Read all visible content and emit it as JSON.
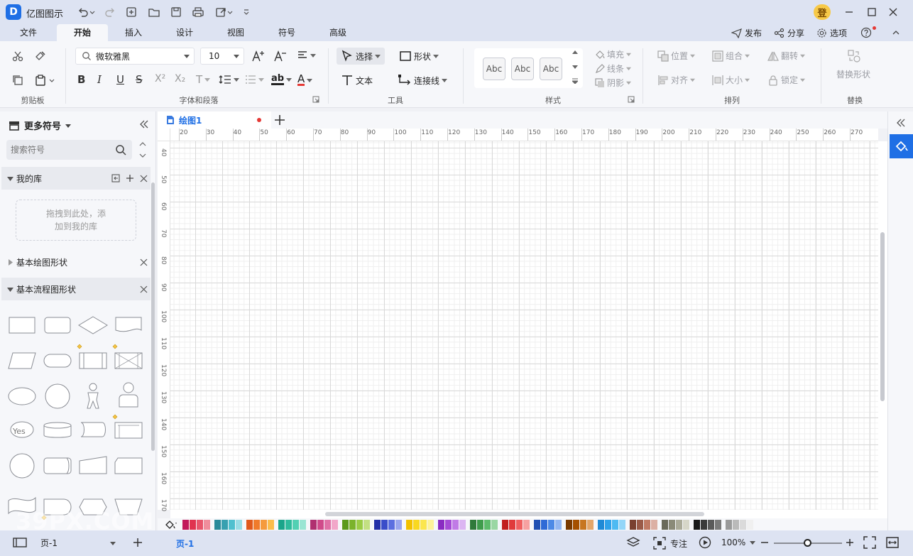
{
  "app": {
    "logo": "D",
    "title": "亿图图示",
    "login": "登"
  },
  "menu": {
    "tabs": [
      {
        "label": "文件",
        "active": false
      },
      {
        "label": "开始",
        "active": true
      },
      {
        "label": "插入",
        "active": false
      },
      {
        "label": "设计",
        "active": false
      },
      {
        "label": "视图",
        "active": false
      },
      {
        "label": "符号",
        "active": false
      },
      {
        "label": "高级",
        "active": false
      }
    ],
    "publish": "发布",
    "share": "分享",
    "options": "选项"
  },
  "ribbon": {
    "groups": {
      "clipboard": "剪贴板",
      "font": "字体和段落",
      "tools": "工具",
      "styles": "样式",
      "arrange": "排列",
      "replace": "替换"
    },
    "font_name": "微软雅黑",
    "font_size": "10",
    "select": "选择",
    "shape": "形状",
    "text": "文本",
    "connector": "连接线",
    "style_sample": "Abc",
    "fill": "填充",
    "line": "线条",
    "shadow": "阴影",
    "position": "位置",
    "group": "组合",
    "flip": "翻转",
    "align": "对齐",
    "size": "大小",
    "lock": "锁定",
    "replace_shape": "替换形状"
  },
  "left_panel": {
    "title": "更多符号",
    "search_placeholder": "搜索符号",
    "my_library": "我的库",
    "drop_hint_line1": "拖拽到此处，添",
    "drop_hint_line2": "加到我的库",
    "basic_shapes": "基本绘图形状",
    "flowchart": "基本流程图形状",
    "yes_label": "Yes"
  },
  "document": {
    "tab": "绘图1"
  },
  "ruler": {
    "h_ticks": [
      "20",
      "30",
      "40",
      "50",
      "60",
      "70",
      "80",
      "90",
      "100",
      "110",
      "120",
      "130",
      "140",
      "150",
      "160",
      "170",
      "180",
      "190",
      "200",
      "210",
      "220",
      "230",
      "240",
      "250",
      "260",
      "270"
    ],
    "v_ticks": [
      "40",
      "50",
      "60",
      "70",
      "80",
      "90",
      "100",
      "110",
      "120",
      "130",
      "140",
      "150",
      "160",
      "170"
    ]
  },
  "palette": {
    "colors": [
      "#c2185b",
      "#e0334f",
      "#e8566c",
      "#f08d9c",
      "#2a8a9a",
      "#36a0b0",
      "#4fc0cf",
      "#9adde6",
      "#e05a1c",
      "#f07b2b",
      "#f59b3b",
      "#fbbd4b",
      "#1ba58a",
      "#2fbb9c",
      "#52d0b3",
      "#9ae5d3",
      "#b03070",
      "#d04a8a",
      "#e070a6",
      "#f2a7c9",
      "#5b9a1c",
      "#7bb32b",
      "#9bcc45",
      "#c3e082",
      "#2330a8",
      "#3a4dc9",
      "#5b6fe0",
      "#9aa6ee",
      "#f2c100",
      "#f9d820",
      "#fbe64e",
      "#fdf29b",
      "#8a2bc2",
      "#a54ad6",
      "#c07be6",
      "#dcb5f2",
      "#2f7a3a",
      "#3f9c4c",
      "#5dbb6b",
      "#9ad7a3",
      "#c11f1f",
      "#e03b3b",
      "#f06060",
      "#f7a1a1",
      "#1f4fb3",
      "#2f6ad6",
      "#4d8ae6",
      "#93b7f2",
      "#7a3a00",
      "#a55000",
      "#c77620",
      "#e2a66a",
      "#1f8ad6",
      "#2fa2ea",
      "#4dbaf2",
      "#93d6f8",
      "#7a4030",
      "#9a5a48",
      "#c07a64",
      "#dcb0a4",
      "#6a6a5a",
      "#8a8a78",
      "#aaaa98",
      "#d6d6c8",
      "#1a1a1a",
      "#3a3a3a",
      "#5a5a5a",
      "#7a7a7a",
      "#9a9a9a",
      "#bababa",
      "#dadada",
      "#f0f0f0"
    ]
  },
  "status": {
    "page_select": "页-1",
    "page_tab": "页-1",
    "focus": "专注",
    "zoom": "100%",
    "zoom_level": 0.5,
    "watermark": "39PX.COM"
  }
}
